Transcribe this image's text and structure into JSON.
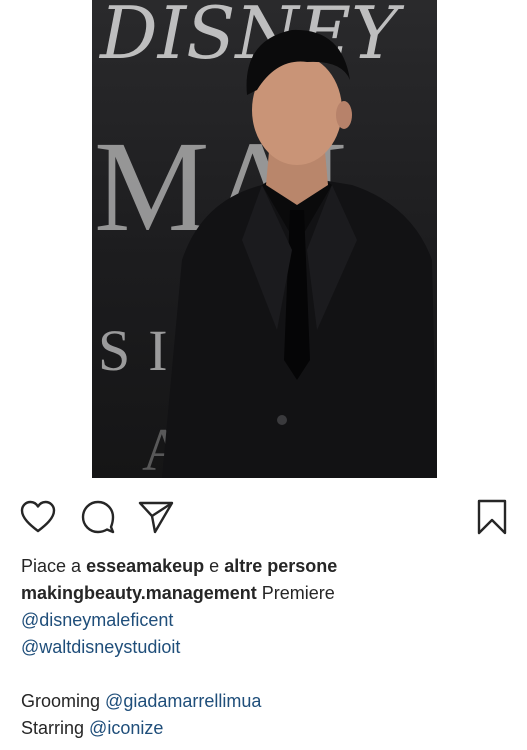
{
  "post": {
    "backdrop_text": {
      "brand": "DISNEY",
      "title_partial": "MAL",
      "subtitle_partial": "SI",
      "bottom_partial": "A"
    }
  },
  "actions": {
    "like_icon": "heart-icon",
    "comment_icon": "comment-icon",
    "share_icon": "paper-plane-icon",
    "save_icon": "bookmark-icon"
  },
  "likes": {
    "prefix": "Piace a",
    "user": "esseamakeup",
    "conjunction": "e",
    "others": "altre persone"
  },
  "caption": {
    "author": "makingbeauty.management",
    "text": "Premiere",
    "mention_1": "@disneymaleficent",
    "mention_2": "@waltdisneystudioit",
    "grooming_label": "Grooming",
    "grooming_mention": "@giadamarrellimua",
    "starring_label": "Starring",
    "starring_mention": "@iconize"
  },
  "colors": {
    "link": "#1f4e7a",
    "text": "#262626",
    "backdrop": "#1c1c1e"
  }
}
